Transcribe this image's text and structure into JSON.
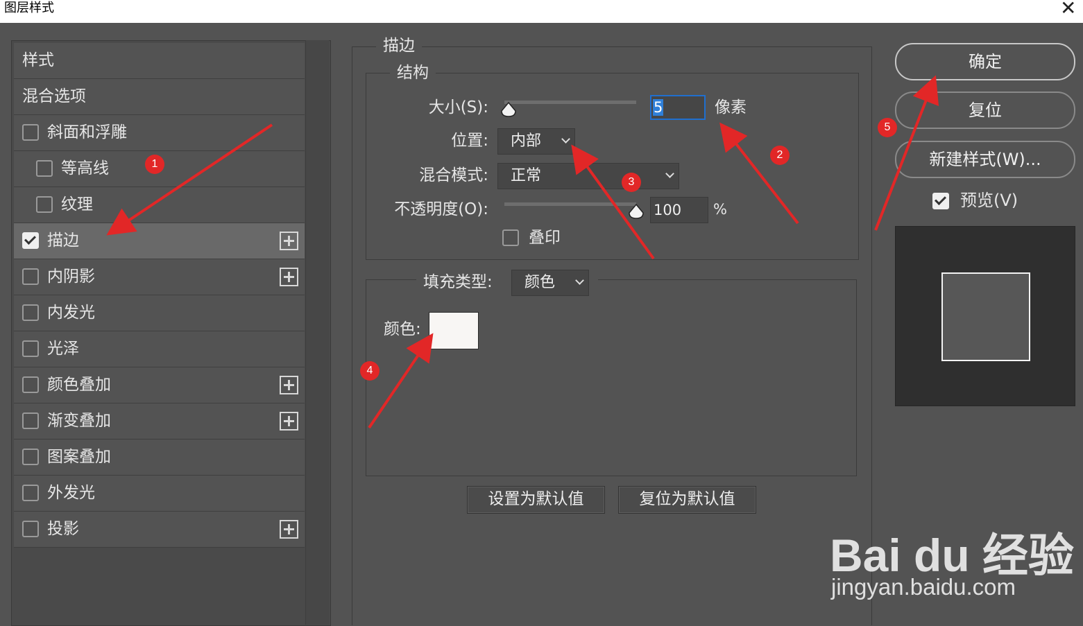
{
  "window": {
    "title": "图层样式",
    "close_glyph": "✕"
  },
  "left_panel": {
    "styles_header": "样式",
    "blend_options": "混合选项",
    "items": [
      {
        "label": "斜面和浮雕",
        "checked": false
      },
      {
        "label": "等高线",
        "checked": false
      },
      {
        "label": "纹理",
        "checked": false
      },
      {
        "label": "描边",
        "checked": true
      },
      {
        "label": "内阴影",
        "checked": false
      },
      {
        "label": "内发光",
        "checked": false
      },
      {
        "label": "光泽",
        "checked": false
      },
      {
        "label": "颜色叠加",
        "checked": false
      },
      {
        "label": "渐变叠加",
        "checked": false
      },
      {
        "label": "图案叠加",
        "checked": false
      },
      {
        "label": "外发光",
        "checked": false
      },
      {
        "label": "投影",
        "checked": false
      }
    ]
  },
  "stroke": {
    "section_title": "描边",
    "structure_title": "结构",
    "size_label": "大小(S):",
    "size_value": "5",
    "size_unit": "像素",
    "position_label": "位置:",
    "position_value": "内部",
    "blend_label": "混合模式:",
    "blend_value": "正常",
    "opacity_label": "不透明度(O):",
    "opacity_value": "100",
    "opacity_unit": "%",
    "overprint_label": "叠印",
    "fill_type_label": "填充类型:",
    "fill_type_value": "颜色",
    "color_label": "颜色:",
    "color_value": "#f8f6f4",
    "make_default": "设置为默认值",
    "reset_default": "复位为默认值"
  },
  "right_panel": {
    "ok": "确定",
    "reset": "复位",
    "new_style": "新建样式(W)...",
    "preview_label": "预览(V)",
    "preview_checked": true
  },
  "annotations": [
    "1",
    "2",
    "3",
    "4",
    "5"
  ],
  "watermark": {
    "brand": "Bai du 经验",
    "url": "jingyan.baidu.com"
  },
  "colors": {
    "bg": "#535353",
    "arrow": "#e22727"
  }
}
